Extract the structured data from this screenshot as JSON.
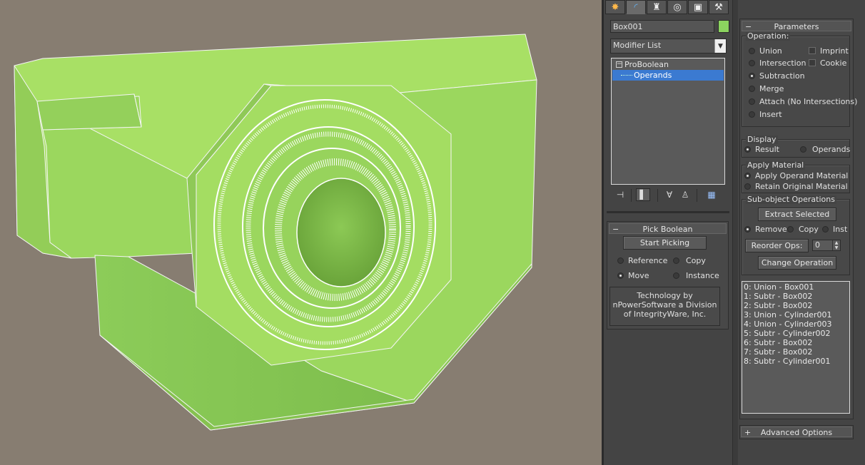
{
  "command_panel": {
    "tabs": [
      {
        "icon": "create-icon",
        "glyph": "✸"
      },
      {
        "icon": "modify-icon",
        "glyph": "◜"
      },
      {
        "icon": "hierarchy-icon",
        "glyph": "♜"
      },
      {
        "icon": "motion-icon",
        "glyph": "◎"
      },
      {
        "icon": "display-icon",
        "glyph": "▣"
      },
      {
        "icon": "utilities-icon",
        "glyph": "⚒"
      }
    ],
    "object_name": "Box001",
    "object_color": "#8bd35f",
    "modifier_list": "Modifier List",
    "stack": {
      "items": [
        "ProBoolean",
        "Operands"
      ],
      "expander": "−"
    },
    "stack_tools": [
      "pin-stack-icon",
      "show-end-result-icon",
      "make-unique-icon",
      "remove-modifier-icon",
      "configure-modifier-sets-icon"
    ]
  },
  "pick_boolean": {
    "title": "Pick Boolean",
    "collapse": "−",
    "start_picking": "Start Picking",
    "options": {
      "reference": "Reference",
      "copy": "Copy",
      "move": "Move",
      "instance": "Instance"
    },
    "selected": "Move",
    "credits": [
      "Technology by",
      "nPowerSoftware a Division",
      "of IntegrityWare, Inc."
    ]
  },
  "parameters": {
    "title": "Parameters",
    "collapse": "−",
    "operation_label": "Operation:",
    "operations": [
      "Union",
      "Intersection",
      "Subtraction",
      "Merge",
      "Attach (No Intersections)",
      "Insert"
    ],
    "selected_operation": "Subtraction",
    "imprint": "Imprint",
    "cookie": "Cookie",
    "display_label": "Display",
    "display_result": "Result",
    "display_operands": "Operands",
    "display_selected": "Result",
    "apply_material_label": "Apply Material",
    "apply_operand_material": "Apply Operand Material",
    "retain_original_material": "Retain Original Material",
    "material_selected": "Apply Operand Material",
    "subobject_label": "Sub-object Operations",
    "extract_selected": "Extract Selected",
    "remove": "Remove",
    "copy": "Copy",
    "inst": "Inst",
    "extract_mode": "Remove",
    "reorder_ops": "Reorder Ops:",
    "reorder_value": "0",
    "change_operation": "Change Operation",
    "operands_list": [
      "0: Union - Box001",
      "1: Subtr - Box002",
      "2: Subtr - Box002",
      "3: Union - Cylinder001",
      "4: Union - Cylinder003",
      "5: Subtr - Cylinder002",
      "6: Subtr - Box002",
      "7: Subtr - Box002",
      "8: Subtr - Cylinder001"
    ]
  },
  "advanced_options": {
    "title": "Advanced Options",
    "expand": "+"
  },
  "viewport": {
    "background": "#877d71",
    "object_color": "#a3dc62"
  }
}
